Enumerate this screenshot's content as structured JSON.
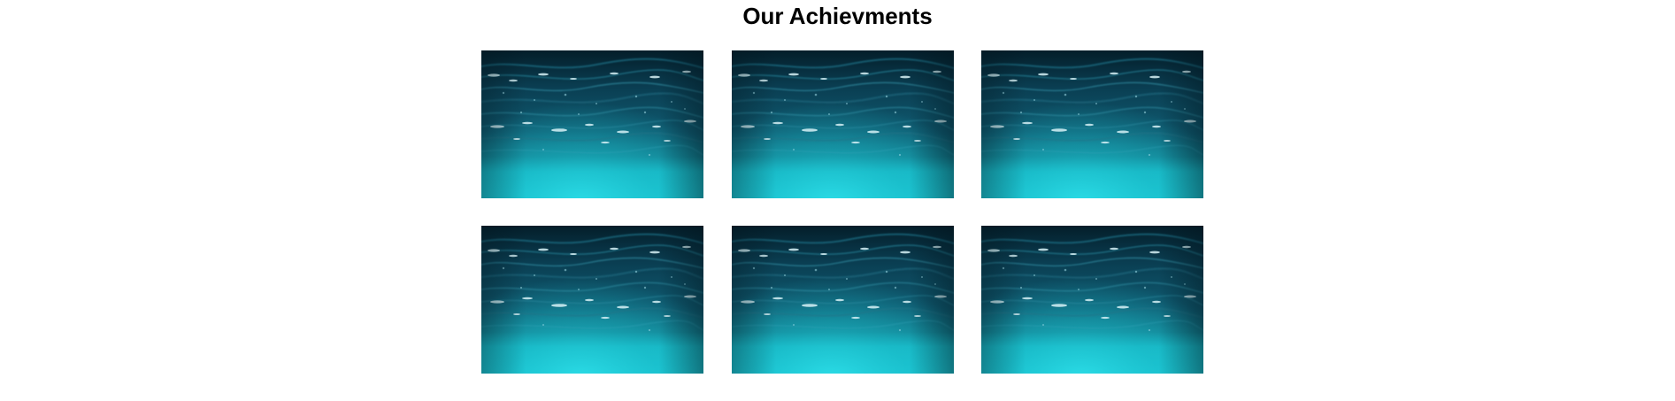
{
  "page": {
    "title": "Our Achievments"
  },
  "gallery": {
    "items": [
      {
        "image": "underwater-ocean-photo"
      },
      {
        "image": "underwater-ocean-photo"
      },
      {
        "image": "underwater-ocean-photo"
      },
      {
        "image": "underwater-ocean-photo"
      },
      {
        "image": "underwater-ocean-photo"
      },
      {
        "image": "underwater-ocean-photo"
      }
    ]
  },
  "colors": {
    "background": "#ffffff",
    "title": "#000000",
    "water_deep": "#062a38",
    "water_mid": "#0e5a72",
    "water_light": "#1fd0dc"
  }
}
